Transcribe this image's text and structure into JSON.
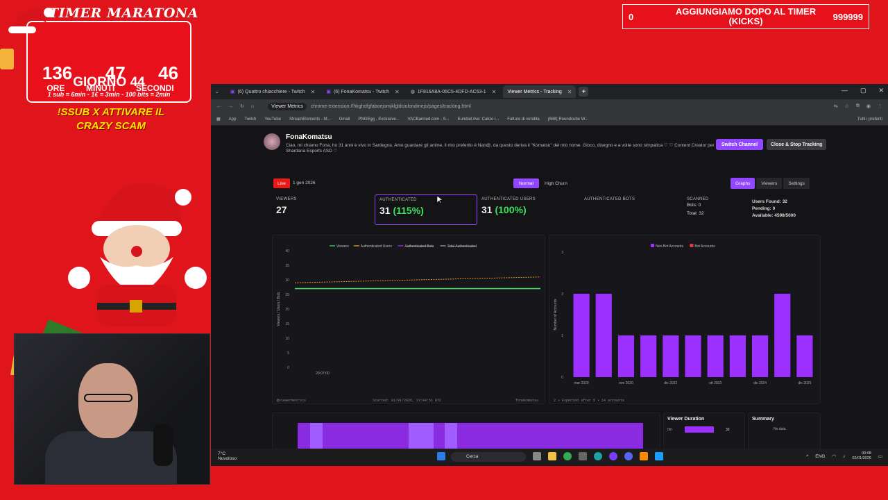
{
  "overlay": {
    "timer_title": "TIMER MARATONA",
    "hours": "136",
    "minutes": "47",
    "seconds": "46",
    "unit_hours": "ORE",
    "unit_minutes": "MINUTI",
    "unit_seconds": "SECONDI",
    "day": "GIORNO 44",
    "rules": "1 sub = 6min - 1€ = 3min - 100 bits = 2min",
    "promo": "!SSUB X ATTIVARE IL CRAZY SCAM",
    "kick_left": "0",
    "kick_text": "AGGIUNGIAMO DOPO AL TIMER (KICKS)",
    "kick_right": "999999"
  },
  "browser": {
    "tabs": [
      {
        "label": "(6) Quattro chiacchiere - Twitch",
        "active": false
      },
      {
        "label": "(6) FonaKomatsu - Twitch",
        "active": false
      },
      {
        "label": "1F816A8A-06C5-4DFD-AC63-1",
        "active": false
      },
      {
        "label": "Viewer Metrics - Tracking",
        "active": true
      }
    ],
    "site_chip": "Viewer Metrics",
    "url": "chrome-extension://hkghcfgfaboejomjklgldciolondmejo/pages/tracking.html",
    "bookmarks": [
      "App",
      "Twitch",
      "YouTube",
      "StreamElements - M...",
      "Gmail",
      "PNGEgg - Exclusive...",
      "VACBanned.com - S...",
      "Eurobet.live: Calcio i...",
      "Fatture di vendita",
      "(688) Roundcube W...",
      "Tutti i preferiti"
    ]
  },
  "channel": {
    "name": "FonaKomatsu",
    "bio": "Ciao, mi chiamo Fona, ho 31 anni e vivo in Sardegna. Amo guardare gli anime, il mio preferito è Nan@, da questo deriva il \"Komatsu\" del mio nome. Gioco, disegno e a volte sono simpatica ♡ ♡ Content Creator per Shardana Esports ASD ♡",
    "switch_label": "Switch Channel",
    "stop_label": "Close & Stop Tracking",
    "live_label": "Live",
    "date_label": "1 gen 2026",
    "mode_normal": "Normal",
    "mode_churn": "High Churn",
    "view_graphs": "Graphs",
    "view_viewers": "Viewers",
    "view_settings": "Settings"
  },
  "stats": {
    "viewers_label": "VIEWERS",
    "viewers_value": "27",
    "auth_label": "AUTHENTICATED",
    "auth_value": "31",
    "auth_pct": "(115%)",
    "authusers_label": "AUTHENTICATED USERS",
    "authusers_value": "31",
    "authusers_pct": "(100%)",
    "authbots_label": "AUTHENTICATED BOTS",
    "scanned_label": "SCANNED",
    "scanned_bots": "Bots: 0",
    "scanned_total": "Total: 32",
    "users_found": "Users Found: 32",
    "pending": "Pending: 0",
    "available": "Available: 4598/5000"
  },
  "line_chart_meta": {
    "footer_left": "@viewermetrics",
    "footer_center": "Started: 01/01/2026, 23:04:51 UTC",
    "footer_right": "fonakomatsu"
  },
  "bar_chart_meta": {
    "footer": "2 • Expected after 5 • 14 accounts"
  },
  "bottom": {
    "duration_title": "Viewer Duration",
    "duration_row_label": "0m",
    "duration_row_value": "32",
    "summary_title": "Summary",
    "summary_text": "No data"
  },
  "taskbar": {
    "weather_temp": "7°C",
    "weather_text": "Nuvoloso",
    "search": "Cerca",
    "lang": "ENG",
    "time": "00:08",
    "date": "02/01/2026"
  },
  "chart_data": [
    {
      "type": "line",
      "ylabel": "Viewers / Users / Bots",
      "ylim": [
        0,
        40
      ],
      "yticks": [
        0,
        5,
        10,
        15,
        20,
        25,
        30,
        35,
        40
      ],
      "xticks": [
        "23:07:00"
      ],
      "legend": [
        "Viewers",
        "Authenticated Users",
        "Authenticated Bots",
        "Total Authenticated"
      ],
      "legend_placement": "top",
      "series": [
        {
          "name": "Viewers",
          "color": "#3ee05e",
          "values": [
            27,
            27
          ]
        },
        {
          "name": "Authenticated Users",
          "color": "#f5a623",
          "values": [
            29,
            31
          ]
        }
      ]
    },
    {
      "type": "bar",
      "ylabel": "Number of Accounts",
      "ylim": [
        0,
        3
      ],
      "yticks": [
        0,
        1,
        2,
        3
      ],
      "legend": [
        "Non-Bot Accounts",
        "Bot Accounts"
      ],
      "legend_placement": "top",
      "colors": {
        "Non-Bot Accounts": "#9b30ff",
        "Bot Accounts": "#e23b3b"
      },
      "xticks": [
        "mar 2020",
        "nov 2020",
        "dic 2022",
        "ott 2023",
        "dic 2024",
        "dic 2025"
      ],
      "series": [
        {
          "name": "Non-Bot Accounts",
          "values": [
            2,
            2,
            1,
            1,
            1,
            1,
            1,
            1,
            1,
            2,
            1
          ]
        }
      ]
    }
  ]
}
